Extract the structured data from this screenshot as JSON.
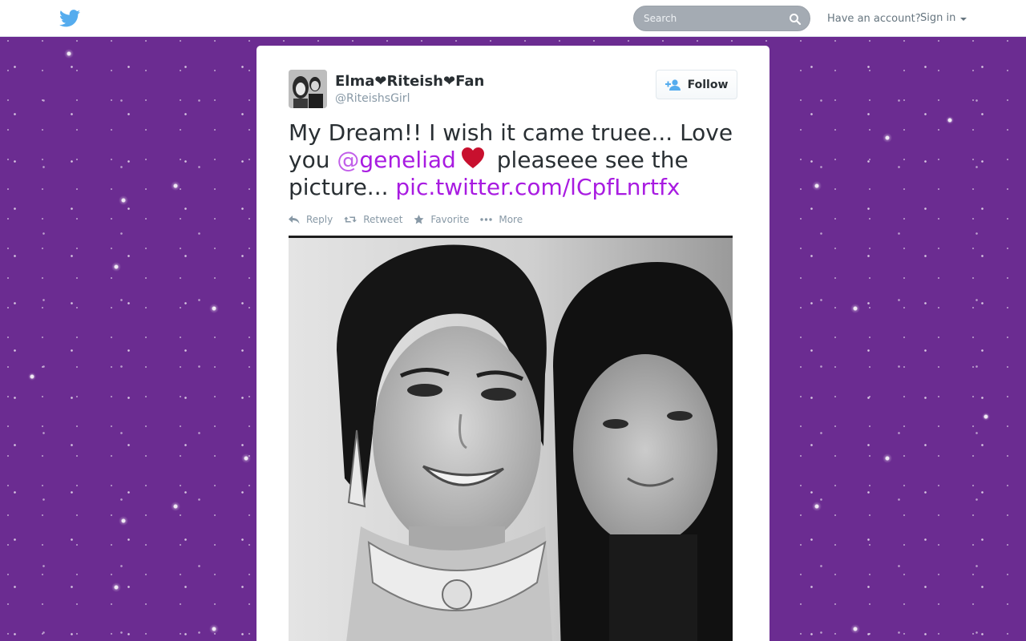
{
  "topbar": {
    "search_placeholder": "Search",
    "have_account": "Have an account?",
    "sign_in": "Sign in"
  },
  "tweet": {
    "fullname": "Elma❤Riteish❤Fan",
    "username": "@RiteishsGirl",
    "follow_label": "Follow",
    "text_1": "My Dream!! I wish it came truee... Love you ",
    "mention_at": "@",
    "mention_name": "geneliad",
    "text_2": " pleaseee see the picture... ",
    "link": "pic.twitter.com/lCpfLnrtfx",
    "actions": {
      "reply": "Reply",
      "retweet": "Retweet",
      "favorite": "Favorite",
      "more": "More"
    }
  },
  "colors": {
    "background": "#6b2c91",
    "link": "#a81be1",
    "twitter_blue": "#55acee",
    "heart": "#c8102e"
  },
  "icons": [
    "twitter-bird-icon",
    "search-icon",
    "caret-down-icon",
    "add-user-icon",
    "reply-icon",
    "retweet-icon",
    "star-icon",
    "ellipsis-icon",
    "heart-icon"
  ]
}
